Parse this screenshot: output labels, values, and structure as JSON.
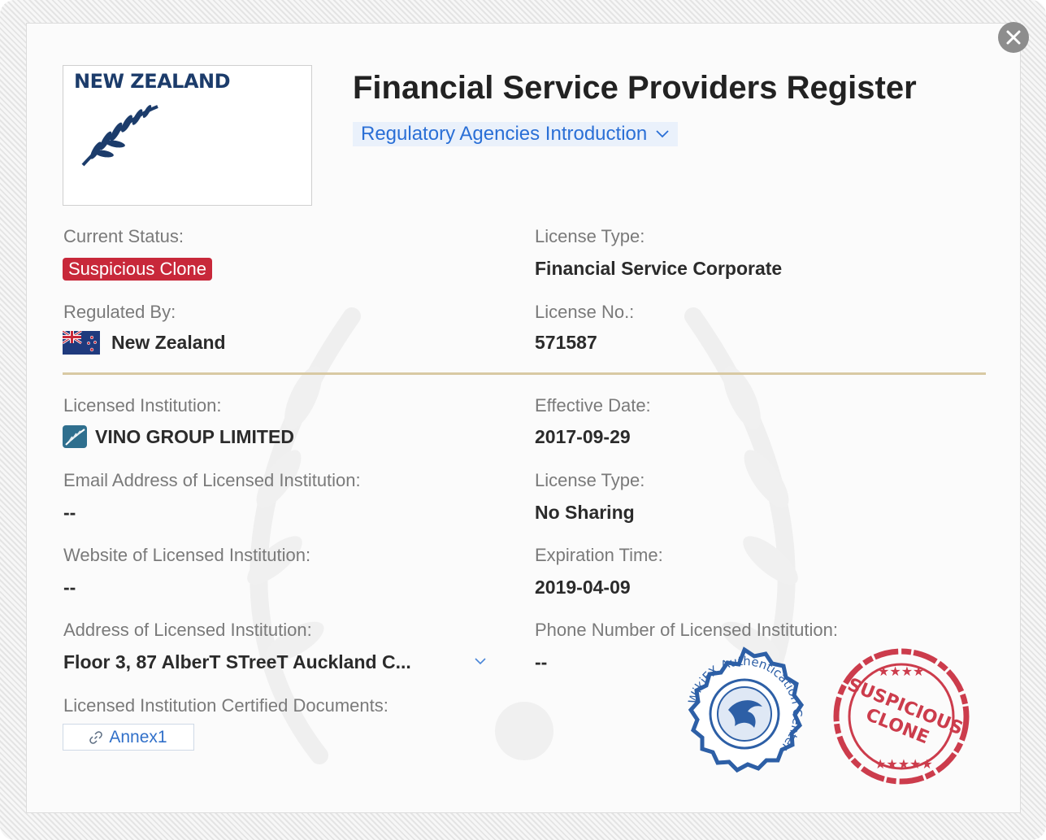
{
  "header": {
    "title": "Financial Service Providers Register",
    "agency_link": "Regulatory Agencies Introduction",
    "logo_text": "NEW ZEALAND"
  },
  "fields": {
    "current_status_label": "Current Status:",
    "current_status_value": "Suspicious Clone",
    "regulated_by_label": "Regulated By:",
    "regulated_by_value": "New Zealand",
    "license_type_label": "License Type:",
    "license_type_value": "Financial Service Corporate",
    "license_no_label": "License No.:",
    "license_no_value": "571587",
    "licensed_institution_label": "Licensed Institution:",
    "licensed_institution_value": "VINO GROUP LIMITED",
    "effective_date_label": "Effective Date:",
    "effective_date_value": "2017-09-29",
    "email_label": "Email Address of Licensed Institution:",
    "email_value": "--",
    "license_type2_label": "License Type:",
    "license_type2_value": "No Sharing",
    "website_label": "Website of Licensed Institution:",
    "website_value": "--",
    "expiration_label": "Expiration Time:",
    "expiration_value": "2019-04-09",
    "address_label": "Address of Licensed Institution:",
    "address_value": "Floor 3, 87 AlberT STreeT Auckland C...",
    "phone_label": "Phone Number of Licensed Institution:",
    "phone_value": "--",
    "documents_label": "Licensed Institution Certified Documents:",
    "annex_label": "Annex1"
  },
  "stamps": {
    "wikifx_text": "WikiFX Authentication Center",
    "suspicious_line1": "SUSPICIOUS",
    "suspicious_line2": "CLONE"
  },
  "colors": {
    "badge_red": "#c8283a",
    "link_blue": "#2a6fd6",
    "divider_gold": "#d8c9a3",
    "stamp_blue": "#2d5fa6",
    "stamp_red": "#c8283a"
  },
  "icons": [
    "close-icon",
    "chevron-down-icon",
    "nz-flag-icon",
    "fern-icon",
    "link-icon"
  ]
}
